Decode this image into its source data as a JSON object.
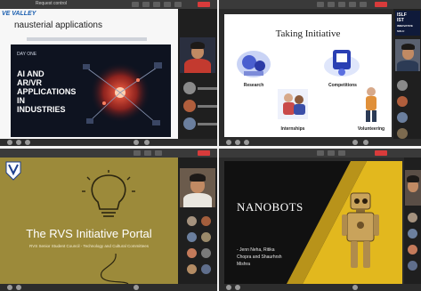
{
  "tiles": {
    "top_left": {
      "topbar_label": "Request control",
      "logo": "VE VALLEY",
      "slide_heading": "nausterial applications",
      "day_badge": "DAY ONE",
      "title_line1": "AI AND AR/VR",
      "title_line2": "APPLICATIONS IN",
      "title_line3": "INDUSTRIES"
    },
    "top_right": {
      "slide_title": "Taking Initiative",
      "items": [
        "Research",
        "Competitions",
        "Internships",
        "Volunteering"
      ],
      "logo_lines": [
        "ISLF",
        "IST",
        "INNOVATIVE SOLU"
      ]
    },
    "bottom_left": {
      "slide_title": "The RVS Initiative Portal",
      "slide_subtitle": "RVS Senior Student Council - Technology and Cultural Committees"
    },
    "bottom_right": {
      "slide_title": "NANOBOTS",
      "credit_line1": "- Jenn Neha, Ritika",
      "credit_line2": "Chopra and Shaurhrsh",
      "credit_line3": "Mishra"
    }
  },
  "colors": {
    "dark_ui": "#2b2b2b",
    "accent_red": "#d83b3b",
    "olive_slide": "#9c8a3a",
    "yellow_panel": "#e2b81e",
    "ai_slide_bg": "#0e1320"
  }
}
